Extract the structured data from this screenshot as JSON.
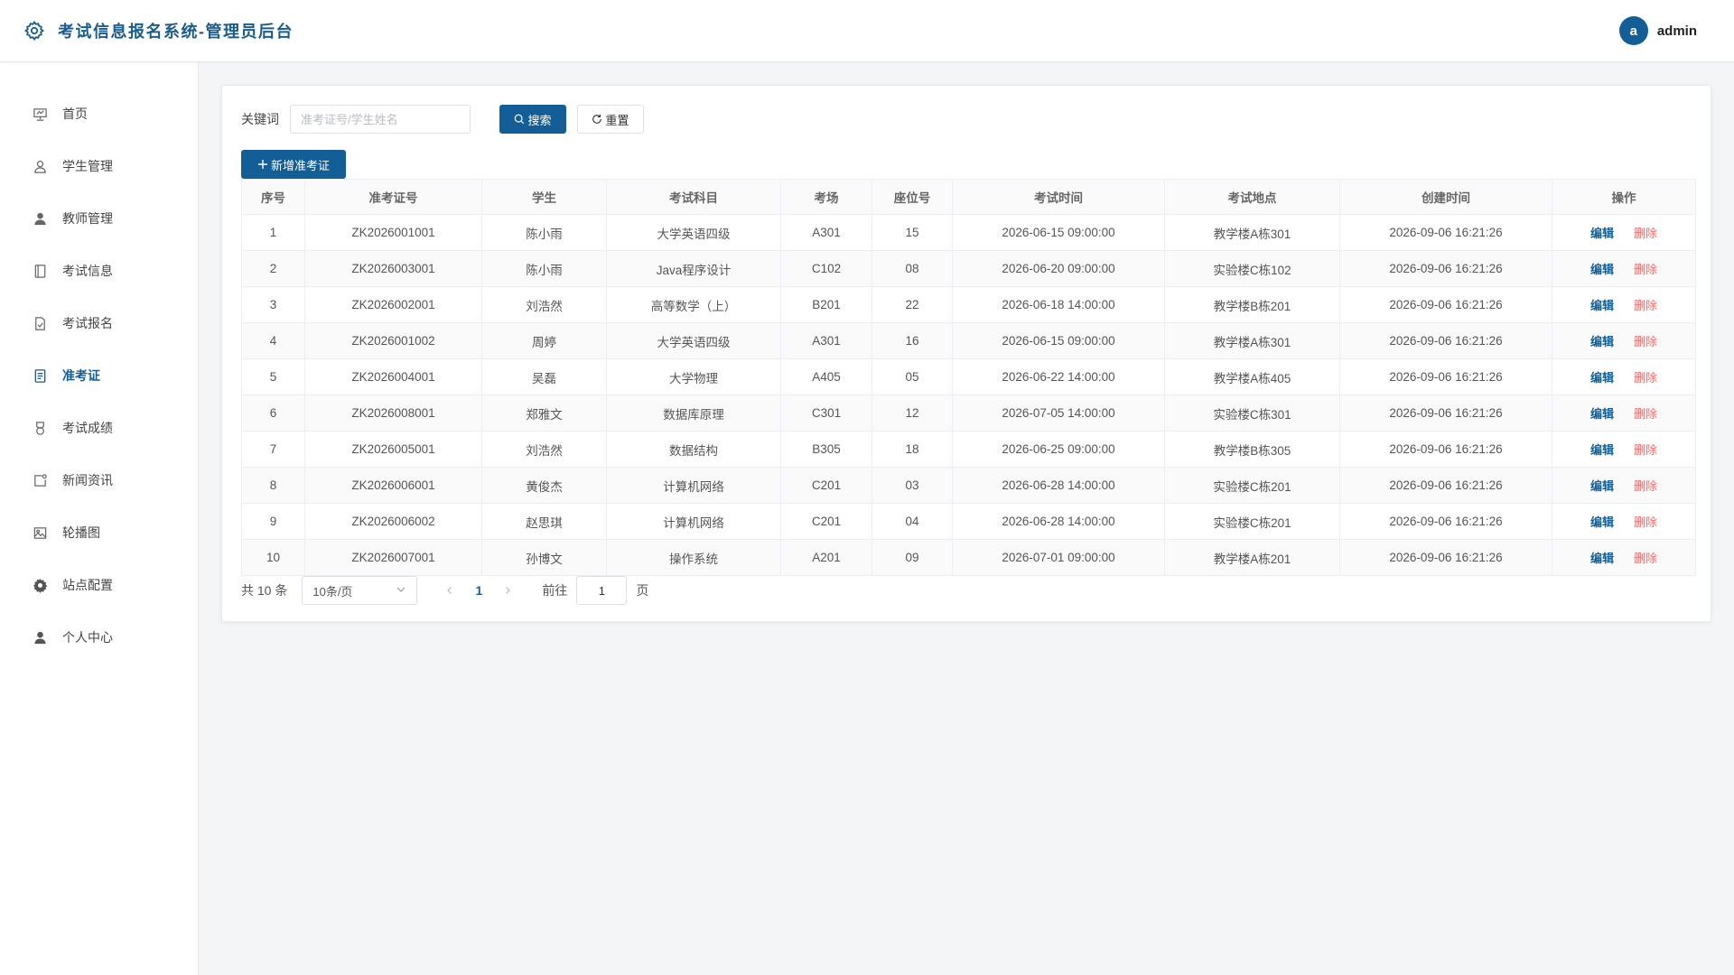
{
  "header": {
    "title": "考试信息报名系统-管理员后台",
    "avatar_letter": "a",
    "username": "admin"
  },
  "sidebar": {
    "items": [
      {
        "label": "首页",
        "icon": "dashboard-icon"
      },
      {
        "label": "学生管理",
        "icon": "user-icon"
      },
      {
        "label": "教师管理",
        "icon": "user-filled-icon"
      },
      {
        "label": "考试信息",
        "icon": "notebook-icon"
      },
      {
        "label": "考试报名",
        "icon": "document-check-icon"
      },
      {
        "label": "准考证",
        "icon": "document-icon",
        "active": true
      },
      {
        "label": "考试成绩",
        "icon": "medal-icon"
      },
      {
        "label": "新闻资讯",
        "icon": "news-icon"
      },
      {
        "label": "轮播图",
        "icon": "picture-icon"
      },
      {
        "label": "站点配置",
        "icon": "gear-icon"
      },
      {
        "label": "个人中心",
        "icon": "user-filled-icon"
      }
    ]
  },
  "search": {
    "label": "关键词",
    "placeholder": "准考证号/学生姓名",
    "value": "",
    "search_label": "搜索",
    "reset_label": "重置"
  },
  "toolbar": {
    "add_label": "新增准考证"
  },
  "table": {
    "columns": [
      "序号",
      "准考证号",
      "学生",
      "考试科目",
      "考场",
      "座位号",
      "考试时间",
      "考试地点",
      "创建时间",
      "操作"
    ],
    "edit_label": "编辑",
    "delete_label": "删除",
    "rows": [
      [
        "1",
        "ZK2026001001",
        "陈小雨",
        "大学英语四级",
        "A301",
        "15",
        "2026-06-15 09:00:00",
        "教学楼A栋301",
        "2026-09-06 16:21:26"
      ],
      [
        "2",
        "ZK2026003001",
        "陈小雨",
        "Java程序设计",
        "C102",
        "08",
        "2026-06-20 09:00:00",
        "实验楼C栋102",
        "2026-09-06 16:21:26"
      ],
      [
        "3",
        "ZK2026002001",
        "刘浩然",
        "高等数学（上）",
        "B201",
        "22",
        "2026-06-18 14:00:00",
        "教学楼B栋201",
        "2026-09-06 16:21:26"
      ],
      [
        "4",
        "ZK2026001002",
        "周婷",
        "大学英语四级",
        "A301",
        "16",
        "2026-06-15 09:00:00",
        "教学楼A栋301",
        "2026-09-06 16:21:26"
      ],
      [
        "5",
        "ZK2026004001",
        "吴磊",
        "大学物理",
        "A405",
        "05",
        "2026-06-22 14:00:00",
        "教学楼A栋405",
        "2026-09-06 16:21:26"
      ],
      [
        "6",
        "ZK2026008001",
        "郑雅文",
        "数据库原理",
        "C301",
        "12",
        "2026-07-05 14:00:00",
        "实验楼C栋301",
        "2026-09-06 16:21:26"
      ],
      [
        "7",
        "ZK2026005001",
        "刘浩然",
        "数据结构",
        "B305",
        "18",
        "2026-06-25 09:00:00",
        "教学楼B栋305",
        "2026-09-06 16:21:26"
      ],
      [
        "8",
        "ZK2026006001",
        "黄俊杰",
        "计算机网络",
        "C201",
        "03",
        "2026-06-28 14:00:00",
        "实验楼C栋201",
        "2026-09-06 16:21:26"
      ],
      [
        "9",
        "ZK2026006002",
        "赵思琪",
        "计算机网络",
        "C201",
        "04",
        "2026-06-28 14:00:00",
        "实验楼C栋201",
        "2026-09-06 16:21:26"
      ],
      [
        "10",
        "ZK2026007001",
        "孙博文",
        "操作系统",
        "A201",
        "09",
        "2026-07-01 09:00:00",
        "教学楼A栋201",
        "2026-09-06 16:21:26"
      ]
    ]
  },
  "pagination": {
    "total_text": "共 10 条",
    "page_size": "10条/页",
    "current_page": "1",
    "goto_label": "前往",
    "goto_value": "1",
    "page_suffix": "页"
  },
  "colors": {
    "accent": "#135e96",
    "title": "#1a5c8c",
    "danger": "#f56c6c"
  }
}
